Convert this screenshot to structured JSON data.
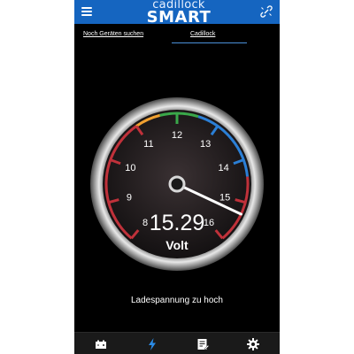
{
  "app": {
    "logo_line1": "cadillock",
    "logo_line2": "SMART",
    "menu_icon": "hamburger-menu-icon",
    "link_icon": "link-icon"
  },
  "tabs": [
    {
      "label": "Noch Geräten suchen",
      "active": false
    },
    {
      "label": "Cadillock",
      "active": true
    }
  ],
  "gauge": {
    "unit": "Volt",
    "value": "15.29",
    "ticks": [
      "8",
      "9",
      "10",
      "11",
      "12",
      "13",
      "14",
      "15",
      "16"
    ],
    "min": 8,
    "max": 16,
    "colors": {
      "low": "#c0313a",
      "mid_low": "#f0a030",
      "ok": "#3aa84a",
      "high": "#2b7fd6",
      "over": "#c0313a"
    }
  },
  "status": {
    "message": "Ladespannung zu hoch"
  },
  "bottom_nav": [
    {
      "icon": "battery-icon",
      "active": false
    },
    {
      "icon": "lightning-icon",
      "active": true
    },
    {
      "icon": "notes-icon",
      "active": false
    },
    {
      "icon": "gear-icon",
      "active": false
    }
  ],
  "theme": {
    "topbar": "#1565c0",
    "accent": "#2b8ce8",
    "background": "#000000"
  }
}
